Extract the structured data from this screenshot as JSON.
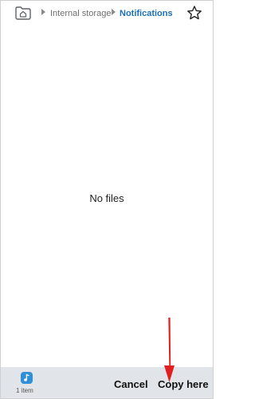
{
  "breadcrumb": {
    "home_icon": "home-folder-icon",
    "items": [
      "Internal storage",
      "Notifications"
    ]
  },
  "header": {
    "favorite_icon": "star-outline-icon"
  },
  "main": {
    "empty_message": "No files"
  },
  "clipboard": {
    "file_icon": "music-file-icon",
    "count_label": "1 item"
  },
  "actions": {
    "cancel_label": "Cancel",
    "copy_label": "Copy here"
  },
  "colors": {
    "accent": "#1d6fb5",
    "bottom_bar": "#e1e4e8",
    "file_icon": "#2f8fd9",
    "annotation_arrow": "#e02020"
  }
}
